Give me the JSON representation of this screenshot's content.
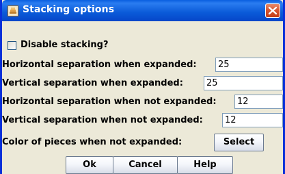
{
  "window": {
    "title": "Stacking options"
  },
  "options": {
    "disable_label": "Disable stacking?",
    "disable_checked": false,
    "h_sep_expanded_label": "Horizontal separation when expanded:",
    "h_sep_expanded_value": "25",
    "v_sep_expanded_label": "Vertical separation when expanded:",
    "v_sep_expanded_value": "25",
    "h_sep_not_expanded_label": "Horizontal separation when not expanded:",
    "h_sep_not_expanded_value": "12",
    "v_sep_not_expanded_label": "Vertical separation when not expanded:",
    "v_sep_not_expanded_value": "12",
    "color_label": "Color of pieces when not expanded:",
    "select_label": "Select"
  },
  "buttons": {
    "ok": "Ok",
    "cancel": "Cancel",
    "help": "Help"
  },
  "icons": {
    "app": "app-icon",
    "close": "close-icon",
    "checkbox": "checkbox-icon"
  }
}
